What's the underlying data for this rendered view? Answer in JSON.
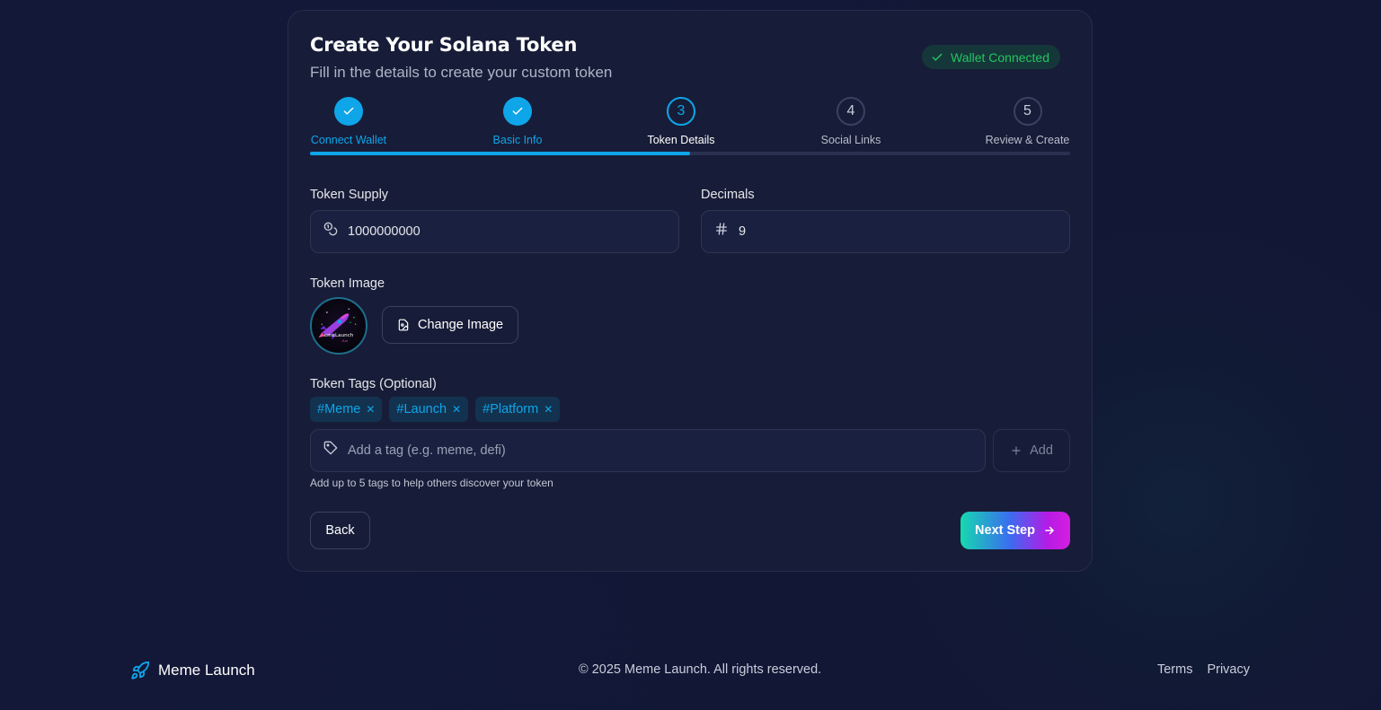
{
  "header": {
    "title": "Create Your Solana Token",
    "subtitle": "Fill in the details to create your custom token",
    "wallet_status": "Wallet Connected"
  },
  "steps": [
    {
      "number": "1",
      "label": "Connect Wallet",
      "state": "done"
    },
    {
      "number": "2",
      "label": "Basic Info",
      "state": "done"
    },
    {
      "number": "3",
      "label": "Token Details",
      "state": "active"
    },
    {
      "number": "4",
      "label": "Social Links",
      "state": "todo"
    },
    {
      "number": "5",
      "label": "Review & Create",
      "state": "todo"
    }
  ],
  "progress": 0.5,
  "form": {
    "supply_label": "Token Supply",
    "supply_value": "1000000000",
    "decimals_label": "Decimals",
    "decimals_value": "9",
    "image_label": "Token Image",
    "change_image": "Change Image",
    "tags_label": "Token Tags (Optional)",
    "tags": [
      "#Meme",
      "#Launch",
      "#Platform"
    ],
    "tag_placeholder": "Add a tag (e.g. meme, defi)",
    "add_label": "Add",
    "tag_hint": "Add up to 5 tags to help others discover your token"
  },
  "nav": {
    "back": "Back",
    "next": "Next Step"
  },
  "footer": {
    "brand": "Meme Launch",
    "copyright": "© 2025 Meme Launch. All rights reserved.",
    "terms": "Terms",
    "privacy": "Privacy"
  },
  "colors": {
    "accent": "#0ea5e9",
    "success": "#22c55e",
    "background": "#131838",
    "card": "#171d38"
  },
  "icons": {
    "check": "check-icon",
    "coins": "coins-icon",
    "hash": "hash-icon",
    "image_file": "file-image-icon",
    "tag": "tag-icon",
    "plus": "plus-icon",
    "arrow": "arrow-right-icon",
    "rocket": "rocket-icon"
  }
}
